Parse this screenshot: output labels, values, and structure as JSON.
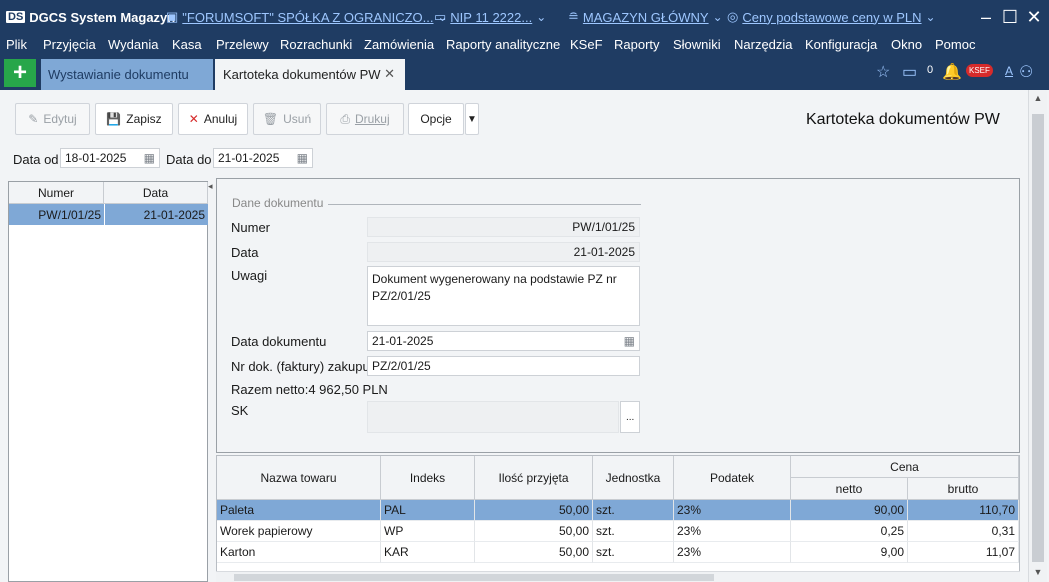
{
  "titlebar": {
    "app_name": "DGCS System Magazyn",
    "logo_text": "DS",
    "company": "\"FORUMSOFT\" SPÓŁKA Z OGRANICZO...",
    "nip": "NIP 11 2222...",
    "warehouse": "MAGAZYN GŁÓWNY",
    "prices": "Ceny podstawowe ceny w PLN"
  },
  "menu": [
    "Plik",
    "Przyjęcia",
    "Wydania",
    "Kasa",
    "Przelewy",
    "Rozrachunki",
    "Zamówienia",
    "Raporty analityczne",
    "KSeF",
    "Raporty",
    "Słowniki",
    "Narzędzia",
    "Konfiguracja",
    "Okno",
    "Pomoc"
  ],
  "tabs": {
    "tab1": "Wystawianie dokumentu",
    "tab2": "Kartoteka dokumentów PW",
    "close": "✕",
    "notif_count": "0",
    "ksef_badge": "KSEF"
  },
  "toolbar": {
    "edit": "Edytuj",
    "save": "Zapisz",
    "cancel": "Anuluj",
    "delete": "Usuń",
    "print": "Drukuj",
    "options": "Opcje"
  },
  "page_title": "Kartoteka dokumentów PW",
  "filters": {
    "date_from_label": "Data od",
    "date_from": "18-01-2025",
    "date_to_label": "Data do",
    "date_to": "21-01-2025"
  },
  "list": {
    "col_number": "Numer",
    "col_date": "Data",
    "rows": [
      {
        "number": "PW/1/01/25",
        "date": "21-01-2025"
      }
    ]
  },
  "form": {
    "section": "Dane dokumentu",
    "number_label": "Numer",
    "number": "PW/1/01/25",
    "date_label": "Data",
    "date": "21-01-2025",
    "notes_label": "Uwagi",
    "notes": "Dokument wygenerowany na podstawie PZ nr PZ/2/01/25",
    "doc_date_label": "Data dokumentu",
    "doc_date": "21-01-2025",
    "invoice_label": "Nr dok. (faktury) zakupu",
    "invoice": "PZ/2/01/25",
    "net_total": "Razem netto:4 962,50 PLN",
    "sk_label": "SK",
    "sk_button": "..."
  },
  "grid": {
    "headers": {
      "name": "Nazwa towaru",
      "index": "Indeks",
      "qty": "Ilość przyjęta",
      "unit": "Jednostka",
      "tax": "Podatek",
      "price": "Cena",
      "net": "netto",
      "gross": "brutto"
    },
    "rows": [
      {
        "name": "Paleta",
        "index": "PAL",
        "qty": "50,00",
        "unit": "szt.",
        "tax": "23%",
        "net": "90,00",
        "gross": "110,70"
      },
      {
        "name": "Worek papierowy",
        "index": "WP",
        "qty": "50,00",
        "unit": "szt.",
        "tax": "23%",
        "net": "0,25",
        "gross": "0,31"
      },
      {
        "name": "Karton",
        "index": "KAR",
        "qty": "50,00",
        "unit": "szt.",
        "tax": "23%",
        "net": "9,00",
        "gross": "11,07"
      }
    ]
  }
}
